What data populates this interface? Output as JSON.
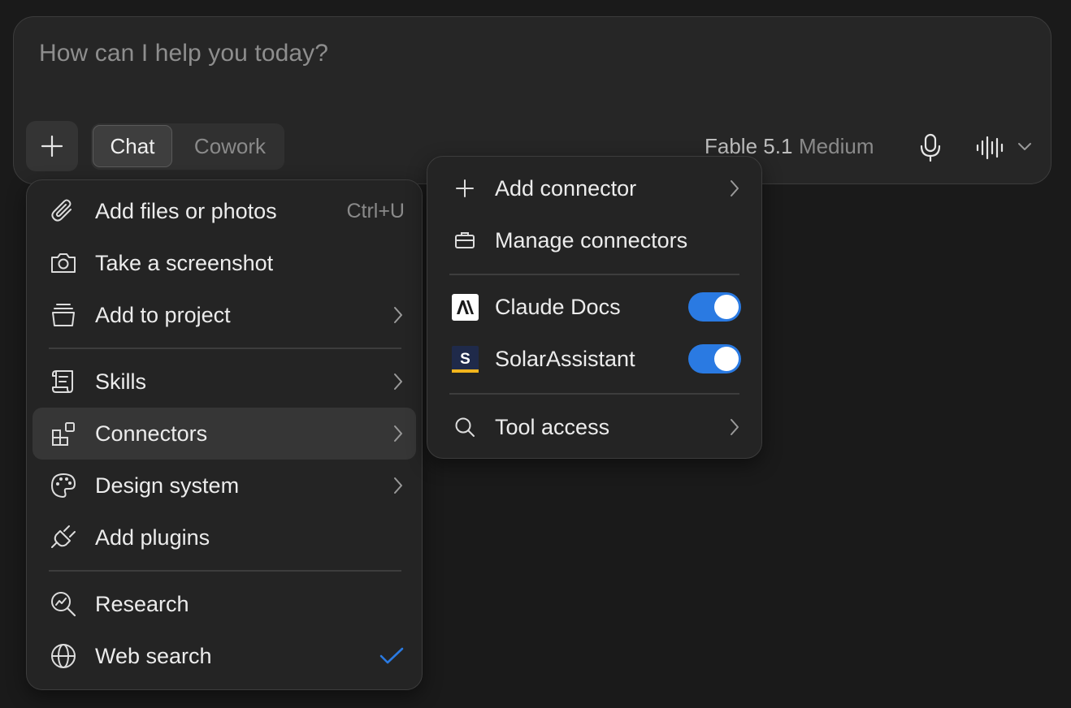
{
  "composer": {
    "placeholder": "How can I help you today?",
    "modes": [
      "Chat",
      "Cowork"
    ],
    "active_mode": "Chat",
    "model_name": "Fable 5.1",
    "model_effort": "Medium"
  },
  "attach_menu": {
    "items": [
      {
        "label": "Add files or photos",
        "shortcut": "Ctrl+U",
        "icon": "paperclip-icon"
      },
      {
        "label": "Take a screenshot",
        "icon": "camera-icon"
      },
      {
        "label": "Add to project",
        "icon": "project-icon",
        "submenu": true
      },
      {
        "label": "Skills",
        "icon": "scroll-icon",
        "submenu": true
      },
      {
        "label": "Connectors",
        "icon": "connectors-icon",
        "submenu": true,
        "highlighted": true
      },
      {
        "label": "Design system",
        "icon": "palette-icon",
        "submenu": true
      },
      {
        "label": "Add plugins",
        "icon": "plug-icon"
      },
      {
        "label": "Research",
        "icon": "research-icon"
      },
      {
        "label": "Web search",
        "icon": "globe-icon",
        "checked": true
      }
    ]
  },
  "connectors_menu": {
    "items": [
      {
        "label": "Add connector",
        "icon": "plus-icon",
        "submenu": true
      },
      {
        "label": "Manage connectors",
        "icon": "briefcase-icon"
      },
      {
        "label": "Claude Docs",
        "icon": "anthropic-logo-icon",
        "enabled": true
      },
      {
        "label": "SolarAssistant",
        "icon": "solarassistant-logo-icon",
        "enabled": true
      },
      {
        "label": "Tool access",
        "icon": "search-icon",
        "submenu": true
      }
    ]
  },
  "colors": {
    "accent": "#2a7ae2",
    "background": "#1a1a1a",
    "panel": "#242424"
  }
}
